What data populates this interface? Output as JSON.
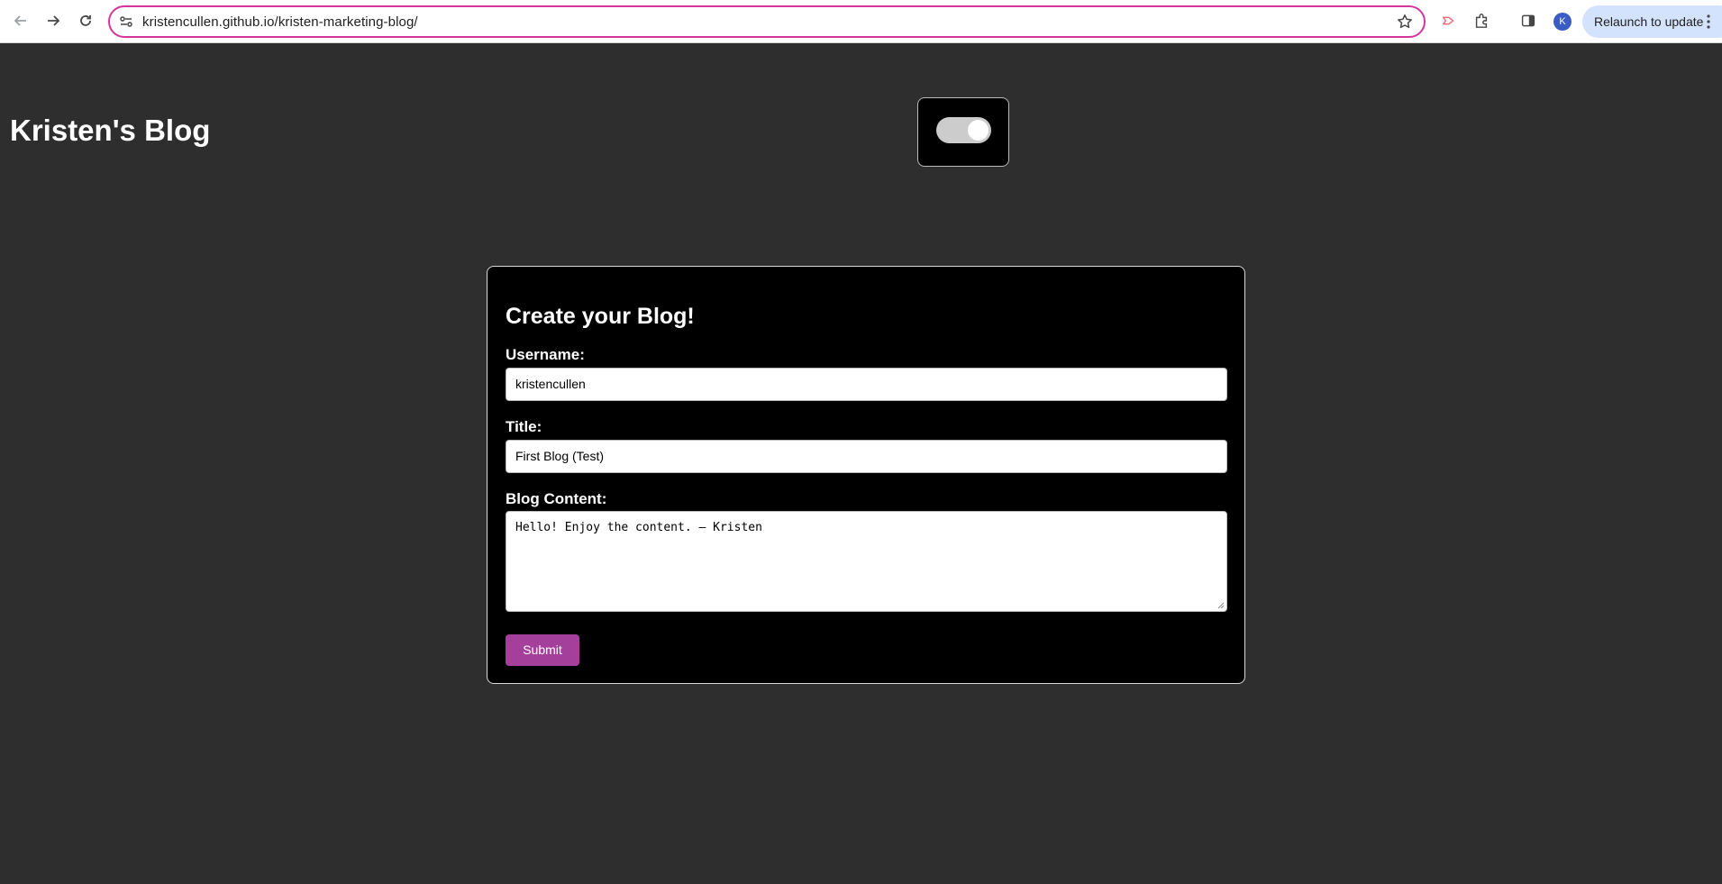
{
  "browser": {
    "url": "kristencullen.github.io/kristen-marketing-blog/",
    "avatar_initial": "K",
    "relaunch_label": "Relaunch to update"
  },
  "page": {
    "site_title": "Kristen's Blog",
    "theme_toggle_on": true
  },
  "form": {
    "heading": "Create your Blog!",
    "username_label": "Username:",
    "username_value": "kristencullen",
    "title_label": "Title:",
    "title_value": "First Blog (Test)",
    "content_label": "Blog Content:",
    "content_value": "Hello! Enjoy the content. – Kristen",
    "submit_label": "Submit"
  },
  "colors": {
    "page_background": "#2e2e2e",
    "card_background": "#000000",
    "submit_button": "#a4409c",
    "omnibox_focus": "#d6359f"
  }
}
